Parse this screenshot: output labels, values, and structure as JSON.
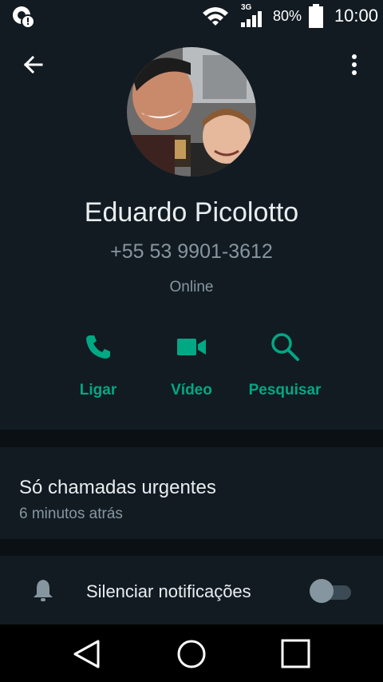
{
  "status_bar": {
    "network_type": "3G",
    "battery_percent": "80%",
    "time": "10:00",
    "icons": [
      "alert-icon",
      "wifi-icon",
      "signal-icon",
      "battery-icon"
    ]
  },
  "header": {
    "back_icon": "arrow-left-icon",
    "menu_icon": "more-vert-icon"
  },
  "contact": {
    "name": "Eduardo Picolotto",
    "phone": "+55 53 9901-3612",
    "presence": "Online"
  },
  "actions": [
    {
      "label": "Ligar",
      "icon": "phone-icon"
    },
    {
      "label": "Vídeo",
      "icon": "video-icon"
    },
    {
      "label": "Pesquisar",
      "icon": "search-icon"
    }
  ],
  "about": {
    "text": "Só chamadas urgentes",
    "updated": "6 minutos atrás"
  },
  "mute": {
    "label": "Silenciar notificações",
    "enabled": false
  },
  "colors": {
    "background": "#121b22",
    "accent": "#00a884",
    "primary_text": "#e9edef",
    "secondary_text": "#8696a0"
  },
  "nav_bar": {
    "icons": [
      "back-triangle-icon",
      "home-circle-icon",
      "recents-square-icon"
    ]
  }
}
